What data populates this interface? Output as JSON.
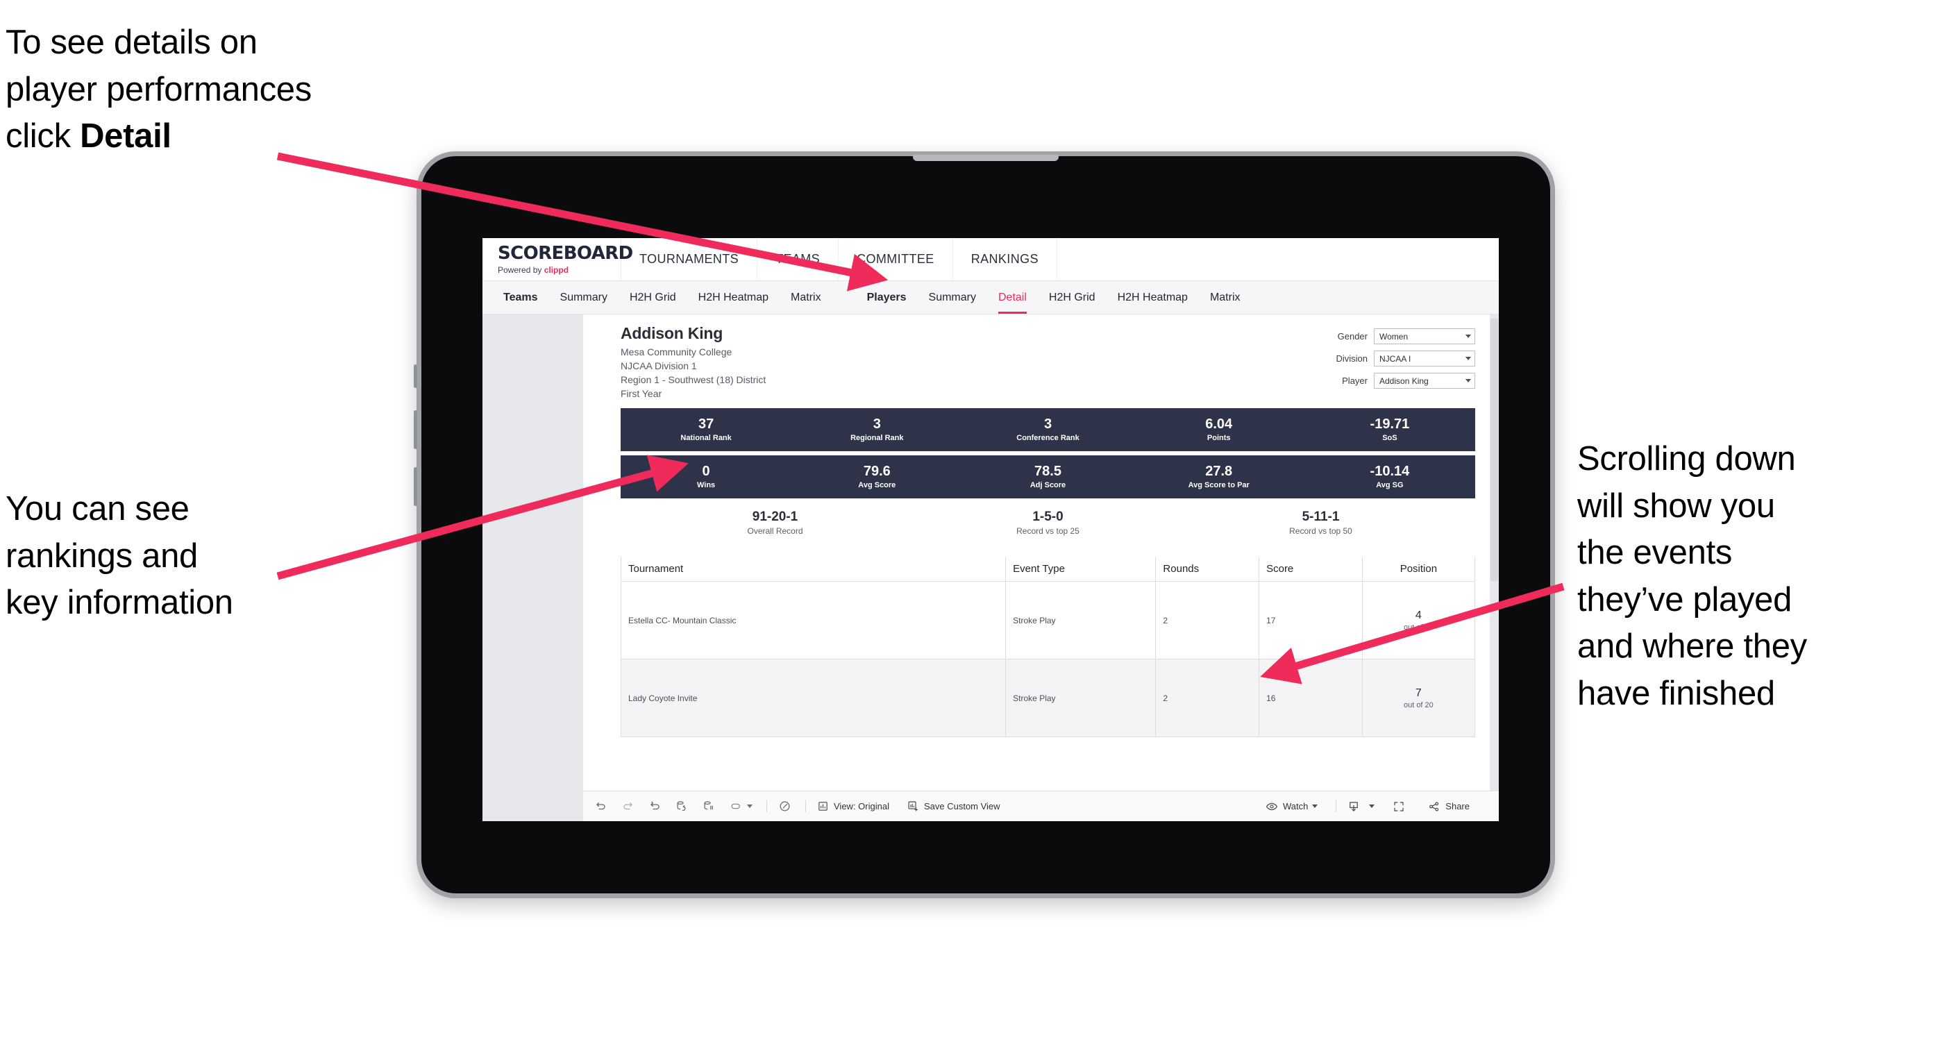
{
  "annotations": {
    "top_left": {
      "line1": "To see details on",
      "line2": "player performances",
      "line3_pre": "click ",
      "line3_bold": "Detail"
    },
    "mid_left": {
      "line1": "You can see",
      "line2": "rankings and",
      "line3": "key information"
    },
    "right": {
      "line1": "Scrolling down",
      "line2": "will show you",
      "line3": "the events",
      "line4": "they’ve played",
      "line5": "and where they",
      "line6": "have finished"
    }
  },
  "brand": {
    "logo": "SCOREBOARD",
    "powered_prefix": "Powered by ",
    "powered_name": "clippd",
    "accent_color": "#ef2b5b"
  },
  "topnav": [
    {
      "label": "TOURNAMENTS"
    },
    {
      "label": "TEAMS"
    },
    {
      "label": "COMMITTEE"
    },
    {
      "label": "RANKINGS"
    }
  ],
  "tabs": {
    "teams_group": [
      {
        "label": "Teams",
        "active": false,
        "head": true
      },
      {
        "label": "Summary",
        "active": false
      },
      {
        "label": "H2H Grid",
        "active": false
      },
      {
        "label": "H2H Heatmap",
        "active": false
      },
      {
        "label": "Matrix",
        "active": false
      }
    ],
    "players_group": [
      {
        "label": "Players",
        "active": false,
        "head": true
      },
      {
        "label": "Summary",
        "active": false
      },
      {
        "label": "Detail",
        "active": true
      },
      {
        "label": "H2H Grid",
        "active": false
      },
      {
        "label": "H2H Heatmap",
        "active": false
      },
      {
        "label": "Matrix",
        "active": false
      }
    ]
  },
  "player": {
    "name": "Addison King",
    "school": "Mesa Community College",
    "division": "NJCAA Division 1",
    "region": "Region 1 - Southwest (18) District",
    "class_year": "First Year"
  },
  "filters": [
    {
      "label": "Gender",
      "value": "Women"
    },
    {
      "label": "Division",
      "value": "NJCAA I"
    },
    {
      "label": "Player",
      "value": "Addison King"
    }
  ],
  "kpis_row1": [
    {
      "value": "37",
      "label": "National Rank"
    },
    {
      "value": "3",
      "label": "Regional Rank"
    },
    {
      "value": "3",
      "label": "Conference Rank"
    },
    {
      "value": "6.04",
      "label": "Points"
    },
    {
      "value": "-19.71",
      "label": "SoS"
    }
  ],
  "kpis_row2": [
    {
      "value": "0",
      "label": "Wins"
    },
    {
      "value": "79.6",
      "label": "Avg Score"
    },
    {
      "value": "78.5",
      "label": "Adj Score"
    },
    {
      "value": "27.8",
      "label": "Avg Score to Par"
    },
    {
      "value": "-10.14",
      "label": "Avg SG"
    }
  ],
  "records": [
    {
      "value": "91-20-1",
      "label": "Overall Record"
    },
    {
      "value": "1-5-0",
      "label": "Record vs top 25"
    },
    {
      "value": "5-11-1",
      "label": "Record vs top 50"
    }
  ],
  "table": {
    "headers": [
      "Tournament",
      "Event Type",
      "Rounds",
      "Score",
      "Position"
    ],
    "rows": [
      {
        "tournament": "Estella CC- Mountain Classic",
        "event_type": "Stroke Play",
        "rounds": "2",
        "score": "17",
        "position": "4",
        "position_of": "out of 20"
      },
      {
        "tournament": "Lady Coyote Invite",
        "event_type": "Stroke Play",
        "rounds": "2",
        "score": "16",
        "position": "7",
        "position_of": "out of 20"
      }
    ]
  },
  "toolbar": {
    "view_label": "View: Original",
    "save_label": "Save Custom View",
    "watch_label": "Watch",
    "share_label": "Share"
  }
}
